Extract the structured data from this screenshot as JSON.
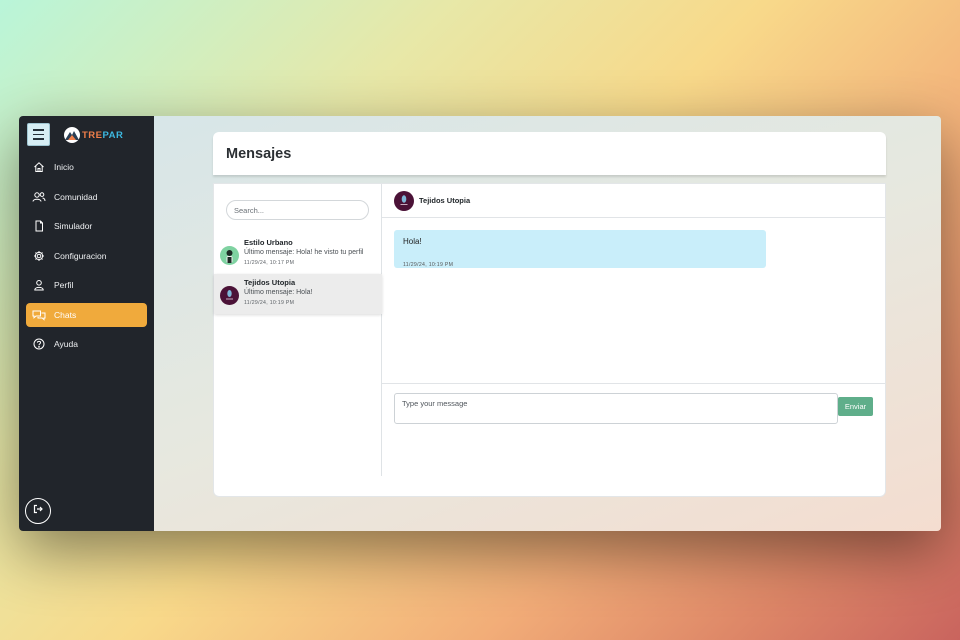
{
  "app": {
    "logo_text_left": "TRE",
    "logo_text_right": "PAR"
  },
  "sidebar": {
    "items": [
      {
        "label": "Inicio",
        "icon": "home-icon"
      },
      {
        "label": "Comunidad",
        "icon": "users-icon"
      },
      {
        "label": "Simulador",
        "icon": "file-icon"
      },
      {
        "label": "Configuracion",
        "icon": "gear-icon"
      },
      {
        "label": "Perfil",
        "icon": "user-icon"
      },
      {
        "label": "Chats",
        "icon": "chat-icon",
        "active": true
      },
      {
        "label": "Ayuda",
        "icon": "help-icon"
      }
    ]
  },
  "page": {
    "title": "Mensajes"
  },
  "conversations": {
    "search_placeholder": "Search...",
    "items": [
      {
        "name": "Estilo Urbano",
        "last_message": "Último mensaje: Hola! he visto tu perfil",
        "time": "11/29/24, 10:17 PM"
      },
      {
        "name": "Tejidos Utopia",
        "last_message": "Último mensaje: Hola!",
        "time": "11/29/24, 10:19 PM",
        "selected": true
      }
    ]
  },
  "chat": {
    "contact_name": "Tejidos Utopia",
    "messages": [
      {
        "text": "Hola!",
        "time": "11/29/24, 10:19 PM"
      }
    ],
    "input_placeholder": "Type your message",
    "send_label": "Enviar"
  },
  "colors": {
    "sidebar_bg": "#21252b",
    "active_item": "#f0aa3c",
    "bubble_bg": "#c9eefa",
    "send_button": "#5fae8a"
  }
}
